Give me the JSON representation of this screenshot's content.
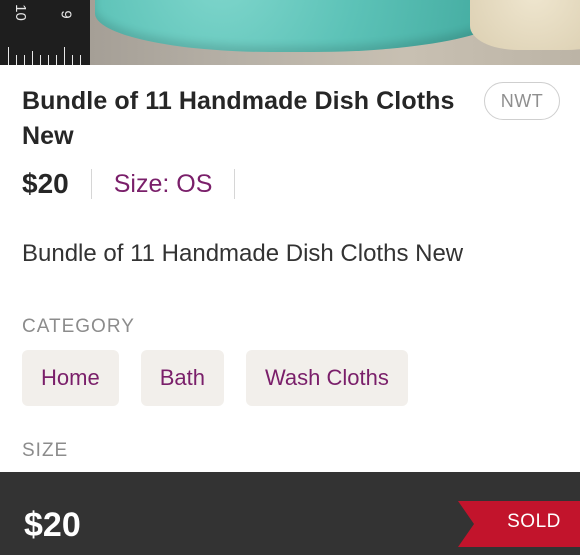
{
  "listing": {
    "title": "Bundle of 11 Handmade Dish Cloths New",
    "condition": "NWT",
    "price": "$20",
    "size": "Size: OS",
    "description": "Bundle of 11 Handmade Dish Cloths New"
  },
  "category": {
    "label": "CATEGORY",
    "chips": [
      "Home",
      "Bath",
      "Wash Cloths"
    ]
  },
  "size_section": {
    "label": "SIZE"
  },
  "bottom_bar": {
    "price": "$20",
    "status": "SOLD"
  },
  "photo": {
    "ruler_numbers": [
      "10",
      "9"
    ]
  },
  "colors": {
    "accent": "#7a1f6a",
    "sold_ribbon": "#c2142c",
    "bottom_bar": "#333333",
    "chip_bg": "#f2efeb"
  }
}
